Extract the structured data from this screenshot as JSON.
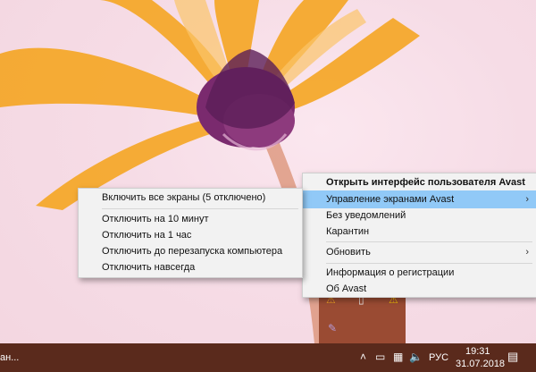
{
  "menu_main": {
    "items": [
      {
        "label": "Открыть интерфейс пользователя Avast"
      },
      {
        "label": "Управление экранами Avast"
      },
      {
        "label": "Без уведомлений"
      },
      {
        "label": "Карантин"
      },
      {
        "label": "Обновить"
      },
      {
        "label": "Информация о регистрации"
      },
      {
        "label": "Об Avast"
      }
    ]
  },
  "submenu": {
    "items": [
      {
        "label": "Включить все экраны (5 отключено)"
      },
      {
        "label": "Отключить на 10 минут"
      },
      {
        "label": "Отключить на 1 час"
      },
      {
        "label": "Отключить до перезапуска компьютера"
      },
      {
        "label": "Отключить навсегда"
      }
    ]
  },
  "taskbar": {
    "left_text": "ан...",
    "lang": "РУС",
    "time": "19:31",
    "date": "31.07.2018"
  },
  "colors": {
    "menu_highlight": "#91c9f7",
    "taskbar": "#5a2a1c"
  }
}
